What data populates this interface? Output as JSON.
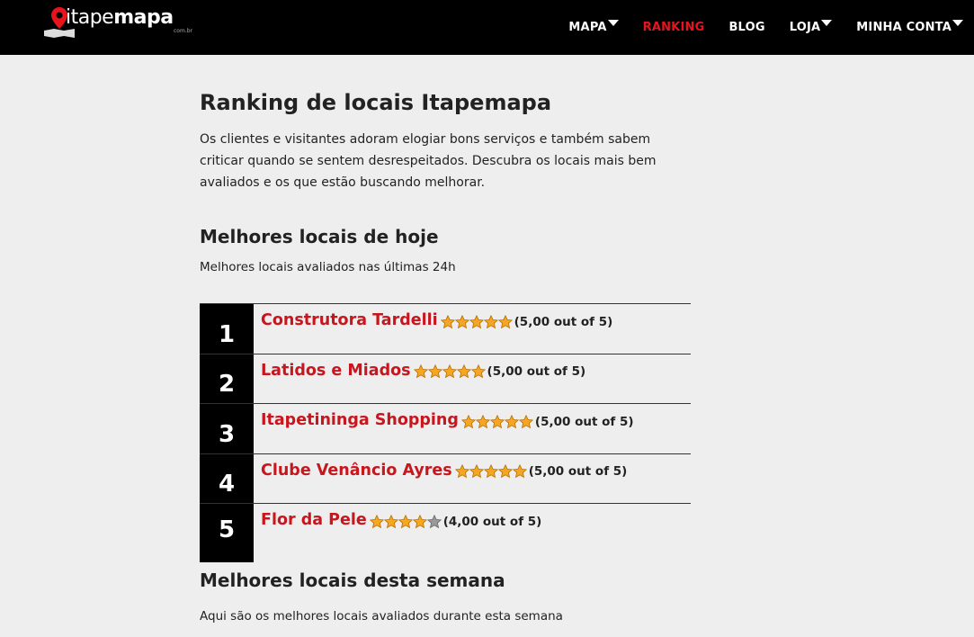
{
  "header": {
    "logo": {
      "light": "itape",
      "bold": "mapa",
      "sub": "com.br"
    },
    "nav": [
      {
        "label": "MAPA",
        "dropdown": true,
        "active": false
      },
      {
        "label": "RANKING",
        "dropdown": false,
        "active": true
      },
      {
        "label": "BLOG",
        "dropdown": false,
        "active": false
      },
      {
        "label": "LOJA",
        "dropdown": true,
        "active": false
      },
      {
        "label": "MINHA CONTA",
        "dropdown": true,
        "active": false
      }
    ]
  },
  "main": {
    "title": "Ranking de locais Itapemapa",
    "intro": "Os clientes e visitantes adoram elogiar bons serviços e também sabem criticar quando se sentem desrespeitados. Descubra os locais mais bem avaliados e os que estão buscando melhorar.",
    "today": {
      "heading": "Melhores locais de hoje",
      "subheading": "Melhores locais avaliados nas últimas 24h",
      "items": [
        {
          "rank": "1",
          "name": "Construtora Tardelli",
          "stars": 5,
          "score": "(5,00 out of 5)"
        },
        {
          "rank": "2",
          "name": "Latidos e Miados",
          "stars": 5,
          "score": "(5,00 out of 5)"
        },
        {
          "rank": "3",
          "name": "Itapetininga Shopping",
          "stars": 5,
          "score": "(5,00 out of 5)"
        },
        {
          "rank": "4",
          "name": "Clube Venâncio Ayres",
          "stars": 5,
          "score": "(5,00 out of 5)"
        },
        {
          "rank": "5",
          "name": "Flor da Pele",
          "stars": 4,
          "score": "(4,00 out of 5)"
        }
      ]
    },
    "week": {
      "heading": "Melhores locais desta semana",
      "subheading": "Aqui são os melhores locais avaliados durante esta semana"
    }
  },
  "colors": {
    "accent": "#e8141c",
    "link": "#c8161e",
    "star_on": "#f5a623",
    "star_off": "#999999"
  }
}
